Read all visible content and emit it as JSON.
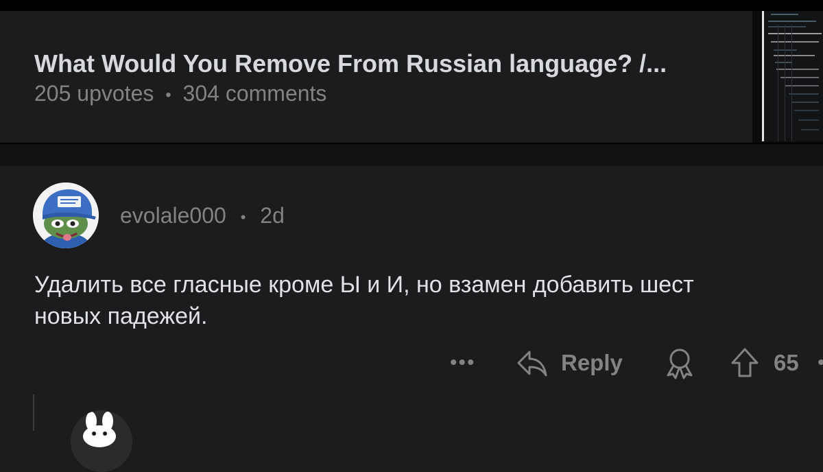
{
  "post": {
    "title": "What Would You Remove From Russian language? /...",
    "upvotes": "205 upvotes",
    "separator": "•",
    "comments": "304 comments"
  },
  "comment": {
    "author": "evolale000",
    "separator": "•",
    "age": "2d",
    "body_line1": "Удалить все гласные кроме Ы и И, но взамен добавить шест",
    "body_line2": "новых падежей."
  },
  "actions": {
    "more_label": "•••",
    "reply_label": "Reply",
    "score": "65",
    "trail": "•"
  },
  "icons": {
    "more": "more-icon",
    "reply": "reply-icon",
    "award": "award-icon",
    "upvote": "upvote-icon"
  },
  "colors": {
    "background": "#1b1c1e",
    "text_primary": "#d7dadc",
    "text_muted": "#818384",
    "divider": "#101112"
  }
}
